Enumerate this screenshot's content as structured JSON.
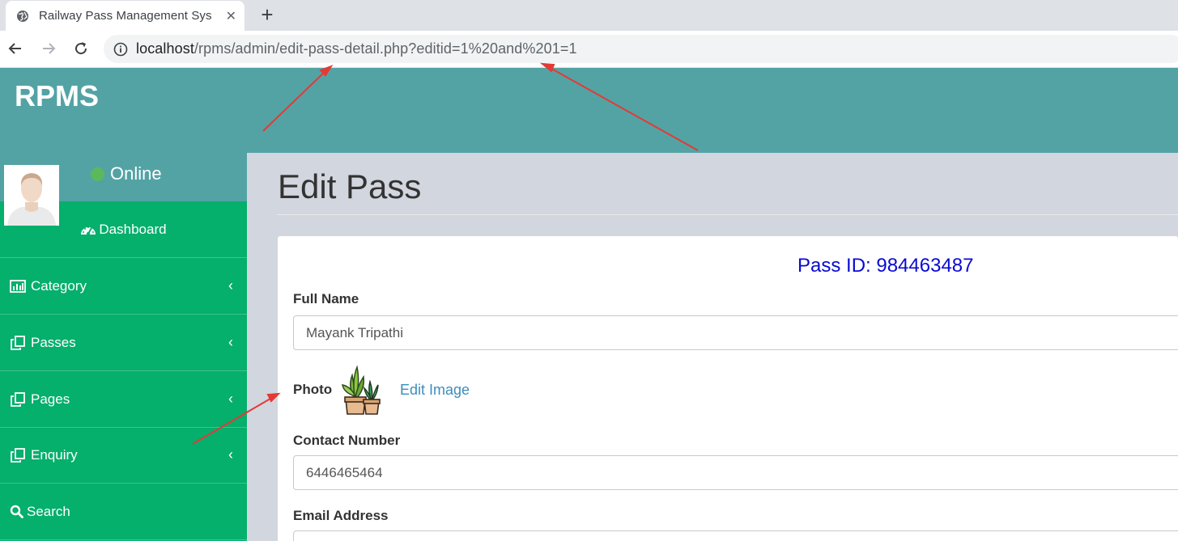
{
  "browser": {
    "tab_title": "Railway Pass Management Sys",
    "tab_close": "✕",
    "new_tab": "+",
    "url_host": "localhost",
    "url_path": "/rpms/admin/edit-pass-detail.php?editid=1%20and%201=1"
  },
  "header": {
    "brand": "RPMS"
  },
  "sidebar": {
    "status": "Online",
    "items": [
      {
        "label": "Dashboard",
        "icon": "dashboard-icon"
      },
      {
        "label": "Category",
        "icon": "bar-chart-icon"
      },
      {
        "label": "Passes",
        "icon": "copy-icon"
      },
      {
        "label": "Pages",
        "icon": "copy-icon"
      },
      {
        "label": "Enquiry",
        "icon": "copy-icon"
      },
      {
        "label": "Search",
        "icon": "search-icon"
      }
    ],
    "chevron": "‹"
  },
  "main": {
    "title": "Edit Pass",
    "pass_id": "Pass ID: 984463487",
    "full_name_label": "Full Name",
    "full_name_value": "Mayank Tripathi",
    "photo_label": "Photo",
    "edit_image": "Edit Image",
    "contact_label": "Contact Number",
    "contact_value": "6446465464",
    "email_label": "Email Address"
  },
  "colors": {
    "header": "#53a3a5",
    "sidebar": "#05af6c",
    "pass_id": "#0a0ad3",
    "link": "#3c8dbc",
    "annotation_arrow": "#e53935"
  }
}
